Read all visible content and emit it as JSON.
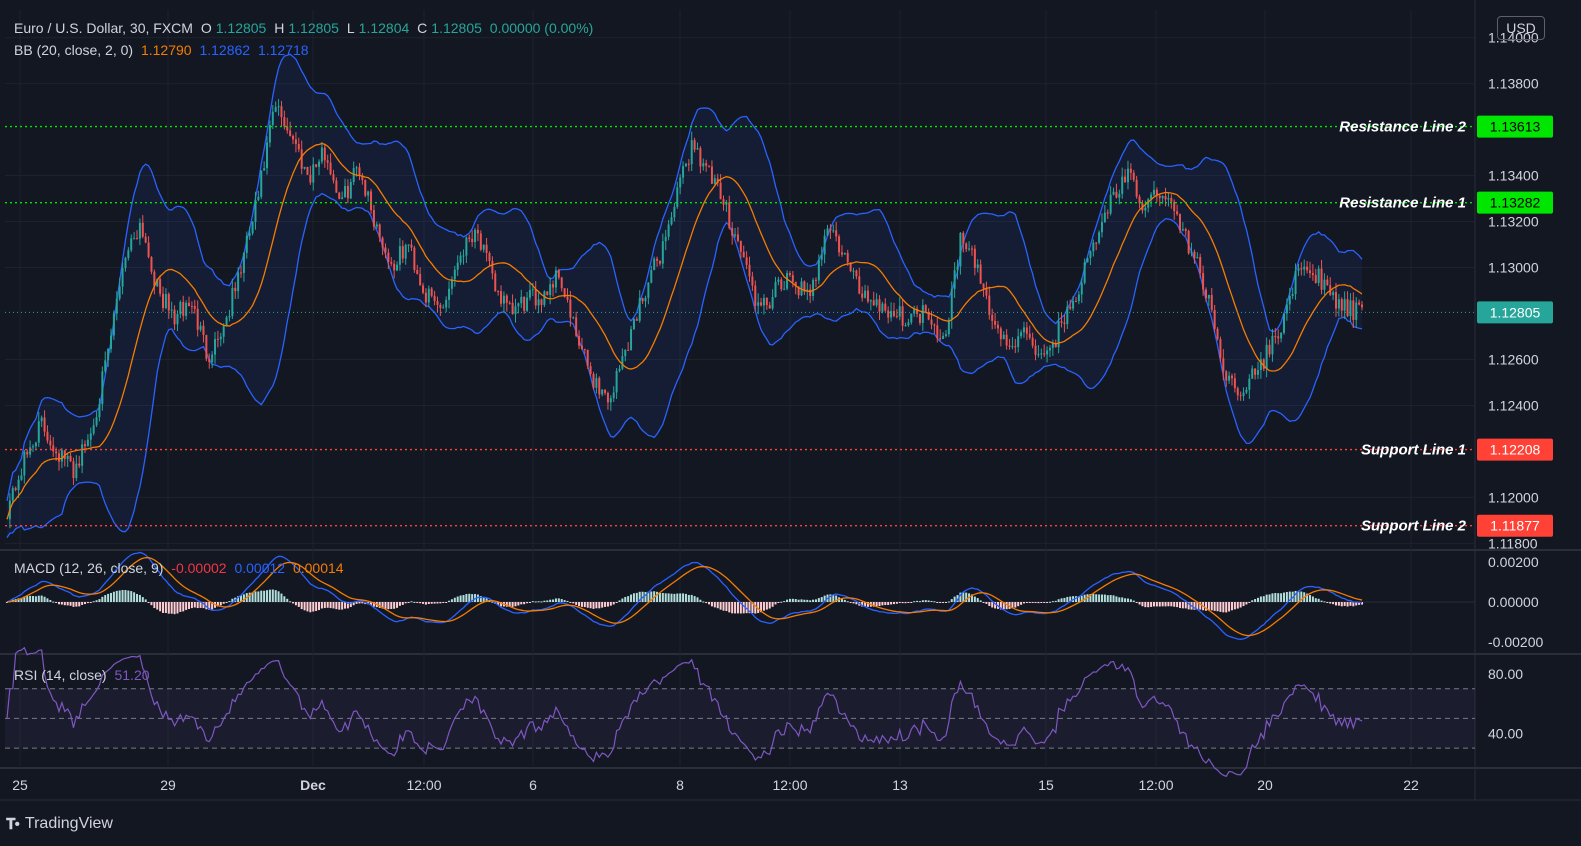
{
  "header": {
    "title": "Euro / U.S. Dollar, 30, FXCM",
    "o_label": "O",
    "o_value": "1.12805",
    "h_label": "H",
    "h_value": "1.12805",
    "l_label": "L",
    "l_value": "1.12804",
    "c_label": "C",
    "c_value": "1.12805",
    "change": "0.00000 (0.00%)"
  },
  "bb_legend": {
    "label": "BB (20, close, 2, 0)",
    "basis": "1.12790",
    "upper": "1.12862",
    "lower": "1.12718"
  },
  "macd_legend": {
    "label": "MACD (12, 26, close, 9)",
    "hist": "-0.00002",
    "macd": "0.00012",
    "signal": "0.00014"
  },
  "rsi_legend": {
    "label": "RSI (14, close)",
    "value": "51.20"
  },
  "currency_button": "USD",
  "brand": "TradingView",
  "colors": {
    "background": "#131722",
    "up": "#26a69a",
    "down": "#ef5350",
    "bb_basis": "#f57c00",
    "bb_band": "#2962ff",
    "resistance": "#00e600",
    "support": "#ff4136",
    "rsi": "#7e57c2",
    "last_price": "#26a69a"
  },
  "chart_data": [
    {
      "type": "candlestick",
      "title": "Euro / U.S. Dollar, 30, FXCM",
      "ylim": [
        1.1178,
        1.1412
      ],
      "y_ticks": [
        "1.14000",
        "1.13800",
        "1.13400",
        "1.13200",
        "1.13000",
        "1.12600",
        "1.12400",
        "1.12000",
        "1.11800"
      ],
      "x_ticks": [
        "25",
        "29",
        "Dec",
        "12:00",
        "6",
        "8",
        "12:00",
        "13",
        "15",
        "12:00",
        "20",
        "22"
      ],
      "price_path": [
        1.1195,
        1.1215,
        1.1232,
        1.122,
        1.1212,
        1.1228,
        1.126,
        1.1305,
        1.132,
        1.129,
        1.1278,
        1.1285,
        1.1262,
        1.1275,
        1.13,
        1.133,
        1.137,
        1.1358,
        1.134,
        1.135,
        1.1328,
        1.1345,
        1.132,
        1.13,
        1.131,
        1.1288,
        1.1282,
        1.1305,
        1.1318,
        1.1295,
        1.128,
        1.1285,
        1.1288,
        1.1298,
        1.127,
        1.1252,
        1.1242,
        1.1265,
        1.1288,
        1.1305,
        1.133,
        1.1355,
        1.134,
        1.1325,
        1.1305,
        1.128,
        1.129,
        1.1295,
        1.1285,
        1.132,
        1.1305,
        1.129,
        1.1285,
        1.128,
        1.1278,
        1.1282,
        1.1268,
        1.1312,
        1.13,
        1.1275,
        1.1265,
        1.1272,
        1.1258,
        1.1275,
        1.129,
        1.131,
        1.133,
        1.134,
        1.1325,
        1.1335,
        1.132,
        1.1305,
        1.128,
        1.125,
        1.1248,
        1.1258,
        1.1272,
        1.1295,
        1.13,
        1.1288,
        1.1282,
        1.128
      ],
      "last_price": "1.12805",
      "levels": [
        {
          "name": "Resistance Line 2",
          "value": 1.13613,
          "label": "1.13613",
          "kind": "resistance"
        },
        {
          "name": "Resistance Line 1",
          "value": 1.13282,
          "label": "1.13282",
          "kind": "resistance"
        },
        {
          "name": "Support Line 1",
          "value": 1.12208,
          "label": "1.12208",
          "kind": "support"
        },
        {
          "name": "Support Line 2",
          "value": 1.11877,
          "label": "1.11877",
          "kind": "support"
        }
      ]
    },
    {
      "type": "line",
      "title": "MACD (12, 26, close, 9)",
      "ylim": [
        -0.0025,
        0.0025
      ],
      "y_ticks": [
        "0.00200",
        "0.00000",
        "-0.00200"
      ],
      "series": [
        {
          "name": "MACD"
        },
        {
          "name": "Signal"
        },
        {
          "name": "Histogram"
        }
      ]
    },
    {
      "type": "line",
      "title": "RSI (14, close)",
      "ylim": [
        18,
        92
      ],
      "y_ticks": [
        "80.00",
        "40.00"
      ],
      "bands": [
        70,
        50,
        30
      ]
    }
  ]
}
